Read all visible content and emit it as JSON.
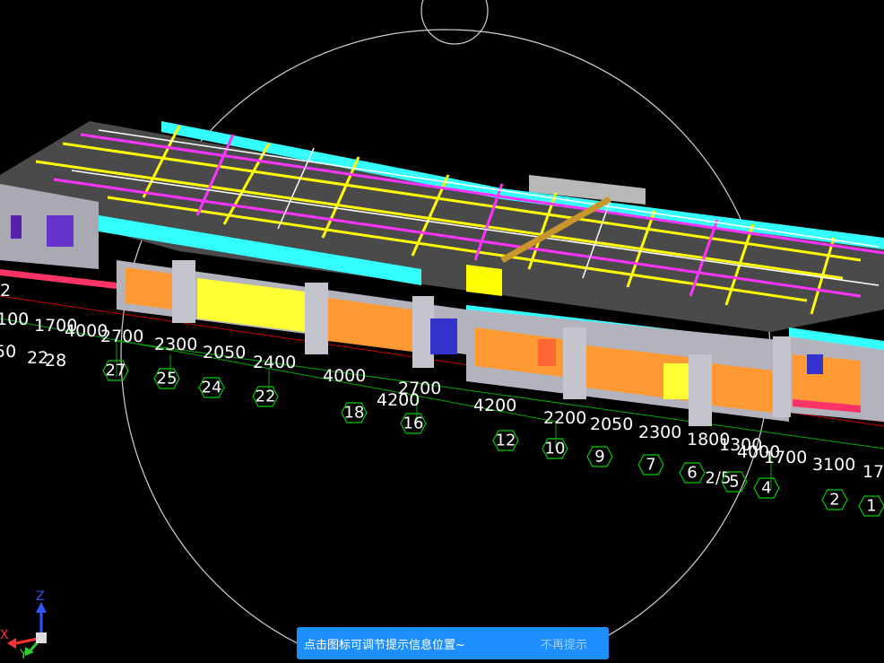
{
  "viewport": {
    "dimensions_along_front": [
      "100",
      "1700",
      "4000",
      "2700",
      "2300",
      "2050",
      "2400",
      "4000",
      "2700",
      "4200",
      "4200",
      "2200",
      "2050",
      "2300",
      "1800",
      "1300",
      "4000",
      "1700",
      "3100",
      "17"
    ],
    "left_dimensions": [
      "50",
      "2",
      "22",
      "28"
    ],
    "axis_labels": [
      "27",
      "25",
      "24",
      "22",
      "18",
      "16",
      "12",
      "10",
      "9",
      "7",
      "6",
      "2/5",
      "5",
      "4",
      "2",
      "1"
    ]
  },
  "hint_bar": {
    "message": "点击图标可调节提示信息位置~",
    "dismiss_label": "不再提示"
  },
  "triad": {
    "x_label": "X",
    "y_label": "Y",
    "z_label": "Z"
  },
  "colors": {
    "background": "#000000",
    "beam_yellow": "#ffff00",
    "beam_magenta": "#ff33ff",
    "slab_cyan": "#33ffff",
    "hint_blue": "#1e8fff"
  }
}
